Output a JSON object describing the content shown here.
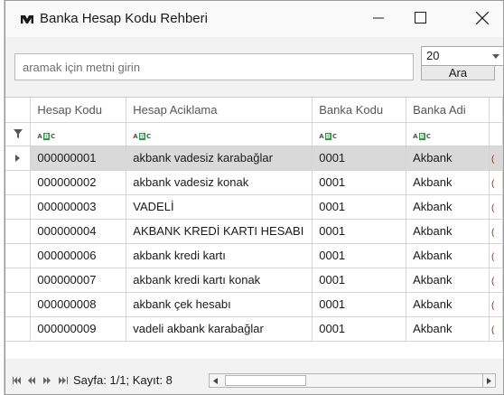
{
  "window": {
    "title": "Banka Hesap Kodu Rehberi",
    "icons": {
      "app": "app-logo-icon",
      "minimize": "minimize-icon",
      "maximize": "maximize-icon",
      "close": "close-icon"
    }
  },
  "search": {
    "placeholder": "aramak için metni girin",
    "button_label": "Ara",
    "page_size": "20"
  },
  "grid": {
    "columns": [
      "Hesap Kodu",
      "Hesap Aciklama",
      "Banka Kodu",
      "Banka Adi"
    ],
    "filter_icon": "filter-icon",
    "text_filter_icon": "abc-text-filter-icon",
    "selected_row_index": 0,
    "rows": [
      {
        "hesap_kodu": "000000001",
        "aciklama": "akbank vadesiz karabağlar",
        "banka_kodu": "0001",
        "banka_adi": "Akbank"
      },
      {
        "hesap_kodu": "000000002",
        "aciklama": "akbank vadesiz konak",
        "banka_kodu": "0001",
        "banka_adi": "Akbank"
      },
      {
        "hesap_kodu": "000000003",
        "aciklama": "VADELİ",
        "banka_kodu": "0001",
        "banka_adi": "Akbank"
      },
      {
        "hesap_kodu": "000000004",
        "aciklama": "AKBANK  KREDİ KARTI HESABI",
        "banka_kodu": "0001",
        "banka_adi": "Akbank"
      },
      {
        "hesap_kodu": "000000006",
        "aciklama": "akbank kredi kartı",
        "banka_kodu": "0001",
        "banka_adi": "Akbank"
      },
      {
        "hesap_kodu": "000000007",
        "aciklama": "akbank kredi kartı konak",
        "banka_kodu": "0001",
        "banka_adi": "Akbank"
      },
      {
        "hesap_kodu": "000000008",
        "aciklama": "akbank çek hesabı",
        "banka_kodu": "0001",
        "banka_adi": "Akbank"
      },
      {
        "hesap_kodu": "000000009",
        "aciklama": "vadeli akbank karabağlar",
        "banka_kodu": "0001",
        "banka_adi": "Akbank"
      }
    ]
  },
  "footer": {
    "page_info": "Sayfa: 1/1; Kayıt: 8",
    "nav_icons": [
      "first-page-icon",
      "previous-page-icon",
      "next-page-icon",
      "last-page-icon"
    ]
  },
  "colors": {
    "selected_row": "#d9d9d9",
    "abc_badge": "#2e9a43",
    "title_bar": "#f9f9f9"
  }
}
